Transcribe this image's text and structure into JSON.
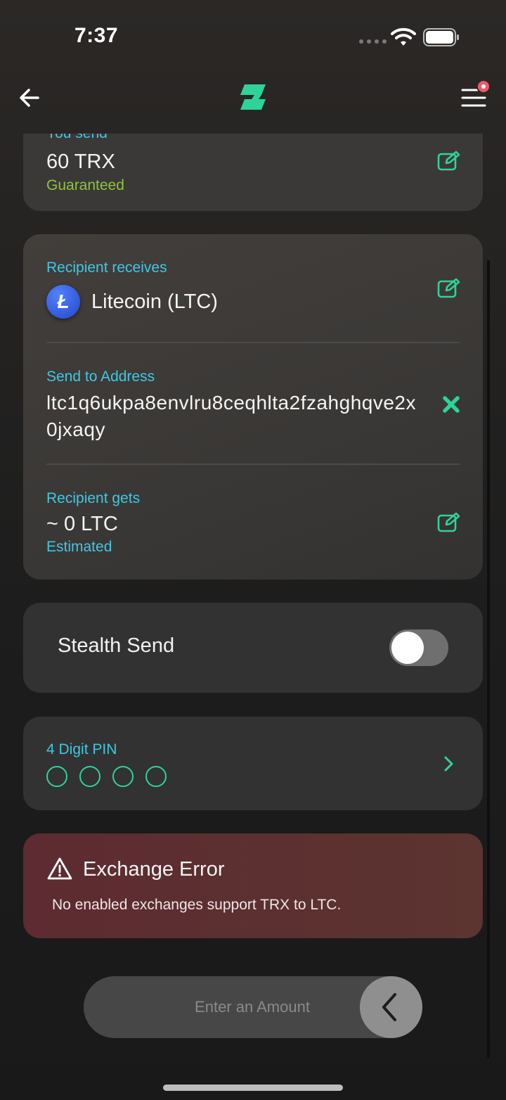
{
  "status": {
    "time": "7:37"
  },
  "nav": {
    "back_icon": "arrow-left-icon",
    "logo_icon": "app-logo-icon",
    "menu_icon": "hamburger-menu-icon",
    "accent": "#2ed39a"
  },
  "send": {
    "label": "You send",
    "amount": "60 TRX",
    "note": "Guaranteed"
  },
  "recipient": {
    "receives_label": "Recipient receives",
    "coin_symbol": "Ł",
    "coin_name": "Litecoin (LTC)",
    "address_label": "Send to Address",
    "address": "ltc1q6ukpa8envlru8ceqhlta2fzahghqve2x0jxaqy",
    "gets_label": "Recipient gets",
    "gets_amount": "~ 0 LTC",
    "gets_note": "Estimated"
  },
  "stealth": {
    "label": "Stealth Send",
    "enabled": false
  },
  "pin": {
    "label": "4 Digit PIN",
    "digits_entered": 0,
    "length": 4
  },
  "error": {
    "title": "Exchange Error",
    "message": "No enabled exchanges support TRX to LTC."
  },
  "cta": {
    "label": "Enter an Amount"
  },
  "colors": {
    "label_blue": "#3fc8e3",
    "green": "#8ec53c",
    "teal": "#2ed39a",
    "error_bg": "#5d2b31"
  }
}
